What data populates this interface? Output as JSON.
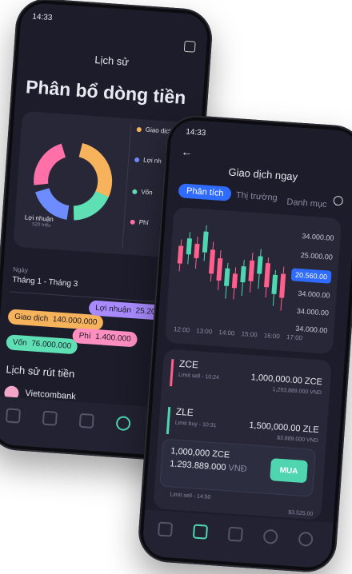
{
  "phone1": {
    "time": "14:33",
    "title": "Lịch sử",
    "heading": "Phân bổ dòng tiền",
    "legend": [
      {
        "label": "Giao dịch",
        "color": "#f7b35c"
      },
      {
        "label": "Lợi nh",
        "color": "#6c8cff"
      },
      {
        "label": "Vốn",
        "color": "#5fe0b4"
      },
      {
        "label": "Phí",
        "color": "#ff6fa8"
      }
    ],
    "donut_label": "Lợi nhuận",
    "donut_sub": "520 triệu",
    "date_label": "Ngày",
    "date_value": "Tháng 1 - Tháng 3",
    "pills": [
      {
        "label": "Giao dịch",
        "value": "140.000.000",
        "color": "#f7b35c"
      },
      {
        "label": "Lợi nhuận",
        "value": "25.20",
        "color": "#a98bff"
      },
      {
        "label": "Vốn",
        "value": "76.000.000",
        "color": "#5fe0b4"
      },
      {
        "label": "Phí",
        "value": "1.400.000",
        "color": "#ff8fc1"
      }
    ],
    "withdraw_title": "Lịch sử rút tiền",
    "bank": "Vietcombank"
  },
  "phone2": {
    "time": "14:33",
    "title": "Giao dịch ngay",
    "tabs": [
      "Phân tích",
      "Thị trường",
      "Danh mục"
    ],
    "prices": [
      "34.000.00",
      "25.000.00",
      "20.560.00",
      "34.000.00",
      "34.000.00",
      "34.000.00"
    ],
    "times": [
      "12:00",
      "13:00",
      "14:00",
      "15:00",
      "16:00",
      "17:00"
    ],
    "orders": [
      {
        "sym": "ZCE",
        "type": "Limit sell - 10:24",
        "amount": "1,000,000.00 ZCE",
        "vnd": "1,293,889.000 VND",
        "color": "#ff5f8c"
      },
      {
        "sym": "ZLE",
        "type": "Limit buy - 10:31",
        "amount": "1,500,000.00 ZLE",
        "vnd": "$3.889.000 VND",
        "color": "#4fd6b0"
      },
      {
        "sym": "",
        "type": "Limit sell - 14:50",
        "amount": "",
        "vnd": "$3.525.00",
        "color": "#ff5f8c"
      }
    ],
    "buybox": {
      "amount": "1,000,000 ZCE",
      "vnd": "1.293.889.000",
      "unit": "VNĐ",
      "btn": "MUA"
    }
  }
}
